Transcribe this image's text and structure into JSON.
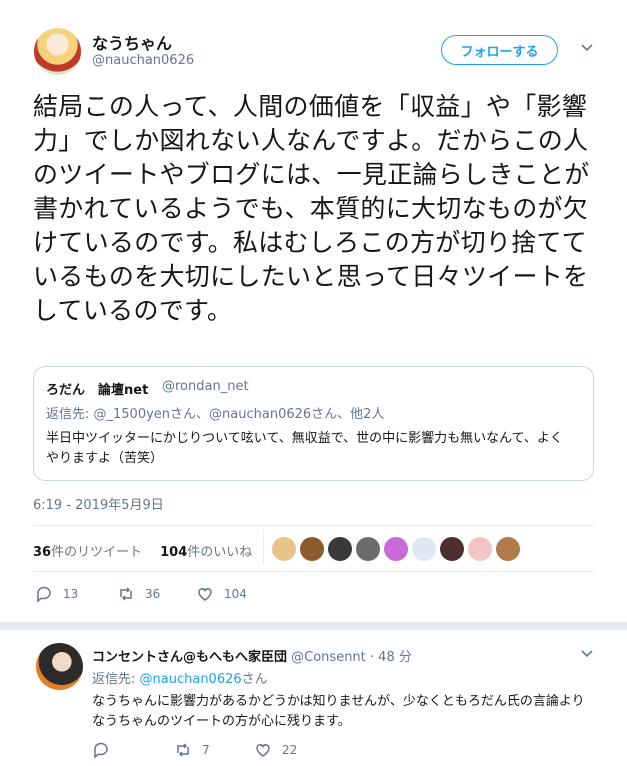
{
  "tweet": {
    "author_name": "なうちゃん",
    "author_handle": "@nauchan0626",
    "follow_label": "フォローする",
    "text": "結局この人って、人間の価値を「収益」や「影響力」でしか図れない人なんですよ。だからこの人のツイートやブログには、一見正論らしきことが書かれているようでも、本質的に大切なものが欠けているのです。私はむしろこの方が切り捨てているものを大切にしたいと思って日々ツイートをしているのです。",
    "timestamp": "6:19 - 2019年5月9日",
    "retweets_count": "36",
    "retweets_label": "件のリツイート",
    "likes_count": "104",
    "likes_label": "件のいいね",
    "actions": {
      "reply": "13",
      "retweet": "36",
      "like": "104"
    }
  },
  "quoted": {
    "name": "ろだん　論壇net",
    "handle": "@rondan_net",
    "reply_to": "返信先: @_1500yenさん、@nauchan0626さん、他2人",
    "text": "半日中ツイッターにかじりついて呟いて、無収益で、世の中に影響力も無いなんて、よくやりますよ（苦笑）"
  },
  "reply": {
    "name": "コンセントさん@もへもへ家臣団",
    "handle": "@Consennt",
    "time": "· 48 分",
    "reply_to_prefix": "返信先: ",
    "reply_to_handle": "@nauchan0626",
    "reply_to_suffix": "さん",
    "text": "なうちゃんに影響力があるかどうかは知りませんが、少なくともろだん氏の言論よりなうちゃんのツイートの方が心に残ります。",
    "actions": {
      "reply": "",
      "retweet": "7",
      "like": "22"
    }
  },
  "colors": {
    "accent": "#1da1f2",
    "muted": "#657786",
    "text": "#14171a",
    "border": "#e6ecf0"
  },
  "likers": [
    "#e8c48a",
    "#8a5a2b",
    "#3a3a3a",
    "#6b6b6b",
    "#c86ad8",
    "#dfe9f3",
    "#4b2e2e",
    "#f3c6c6",
    "#b07a4a"
  ]
}
